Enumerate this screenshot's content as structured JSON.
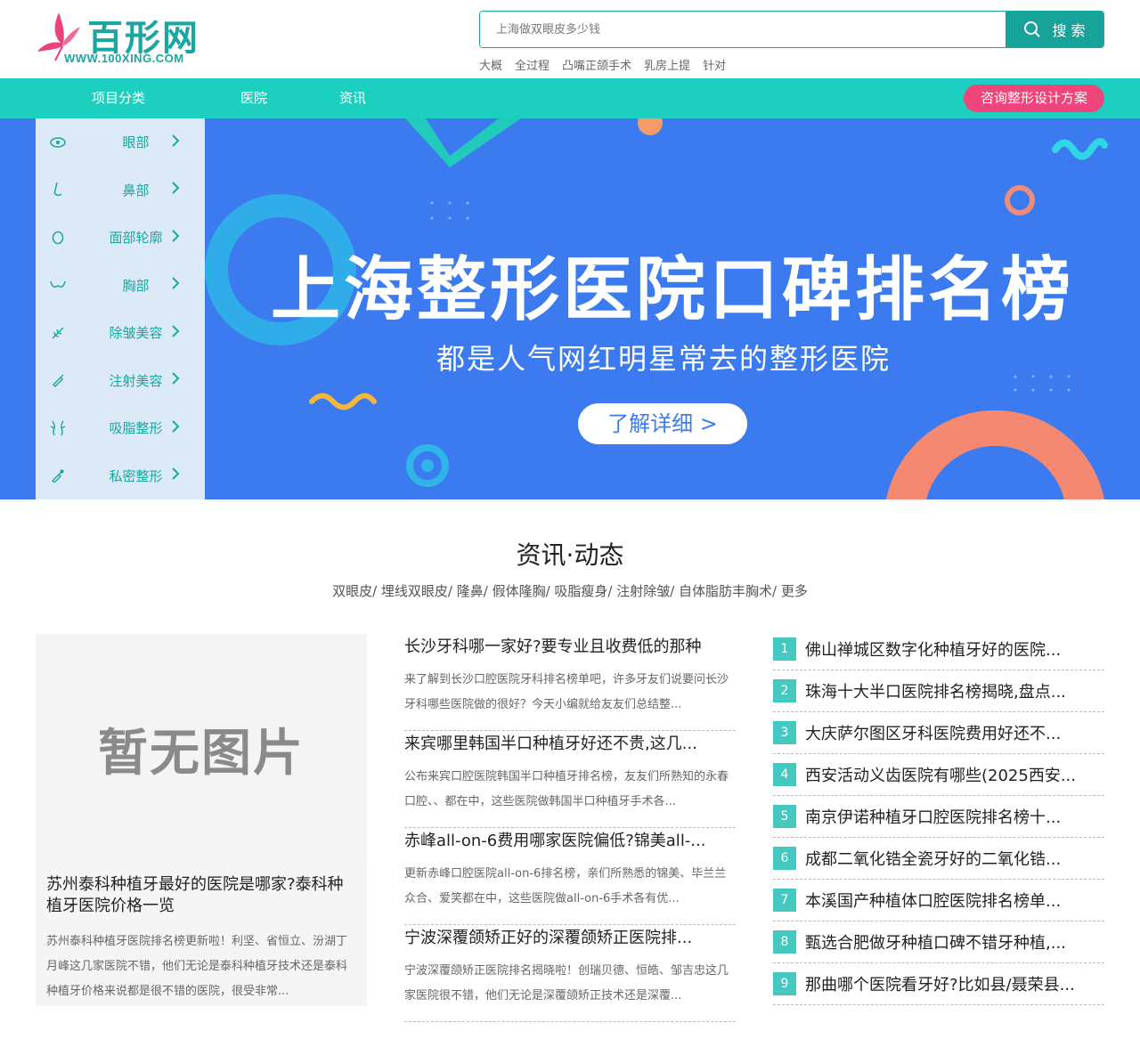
{
  "brand": {
    "name": "百形网",
    "url": "WWW.100XING.COM",
    "colors": {
      "teal": "#1ccfbe",
      "dark_teal": "#17a29a",
      "pink": "#f0457a",
      "banner_blue": "#3b7bef"
    }
  },
  "search": {
    "placeholder": "上海做双眼皮多少钱",
    "button": "搜 索",
    "hot_words": [
      "大概",
      "全过程",
      "凸嘴正颌手术",
      "乳房上提",
      "针对"
    ]
  },
  "nav": {
    "items": [
      "项目分类",
      "医院",
      "资讯"
    ],
    "consult": "咨询整形设计方案"
  },
  "sidebar": {
    "items": [
      {
        "label": "眼部",
        "icon": "eye-icon"
      },
      {
        "label": "鼻部",
        "icon": "nose-icon"
      },
      {
        "label": "面部轮廓",
        "icon": "face-icon"
      },
      {
        "label": "胸部",
        "icon": "chest-icon"
      },
      {
        "label": "除皱美容",
        "icon": "feather-icon"
      },
      {
        "label": "注射美容",
        "icon": "syringe-icon"
      },
      {
        "label": "吸脂整形",
        "icon": "body-icon"
      },
      {
        "label": "私密整形",
        "icon": "dropper-icon"
      }
    ]
  },
  "banner": {
    "title": "上海整形医院口碑排名榜",
    "subtitle": "都是人气网红明星常去的整形医院",
    "button": "了解详细 >"
  },
  "news": {
    "title": "资讯·动态",
    "tags": "双眼皮/ 埋线双眼皮/ 隆鼻/ 假体隆胸/ 吸脂瘦身/ 注射除皱/ 自体脂肪丰胸术/ 更多",
    "feature": {
      "image_text": "暂无图片",
      "title": "苏州泰科种植牙最好的医院是哪家?泰科种植牙医院价格一览",
      "desc": "苏州泰科种植牙医院排名榜更新啦！利坚、省恒立、汾湖丁月峰这几家医院不错，他们无论是泰科种植牙技术还是泰科种植牙价格来说都是很不错的医院，很受非常..."
    },
    "middle": [
      {
        "title": "长沙牙科哪一家好?要专业且收费低的那种",
        "desc": "来了解到长沙口腔医院牙科排名榜单吧，许多牙友们说要问长沙牙科哪些医院做的很好？今天小编就给友友们总结整..."
      },
      {
        "title": "来宾哪里韩国半口种植牙好还不贵,这几...",
        "desc": "公布来宾口腔医院韩国半口种植牙排名榜，友友们所熟知的永春口腔、、都在中，这些医院做韩国半口种植牙手术各..."
      },
      {
        "title": "赤峰all-on-6费用哪家医院偏低?锦美all-...",
        "desc": "更新赤峰口腔医院all-on-6排名榜，亲们所熟悉的锦美、毕兰兰众合、爱笑都在中，这些医院做all-on-6手术各有优..."
      },
      {
        "title": "宁波深覆颌矫正好的深覆颌矫正医院排...",
        "desc": "宁波深覆颌矫正医院排名揭晓啦！创瑞贝德、恒皓、邹吉忠这几家医院很不错，他们无论是深覆颌矫正技术还是深覆..."
      }
    ],
    "ranking": [
      {
        "num": "1",
        "title": "佛山禅城区数字化种植牙好的医院..."
      },
      {
        "num": "2",
        "title": "珠海十大半口医院排名榜揭晓,盘点..."
      },
      {
        "num": "3",
        "title": "大庆萨尔图区牙科医院费用好还不..."
      },
      {
        "num": "4",
        "title": "西安活动义齿医院有哪些(2025西安..."
      },
      {
        "num": "5",
        "title": "南京伊诺种植牙口腔医院排名榜十..."
      },
      {
        "num": "6",
        "title": "成都二氧化锆全瓷牙好的二氧化锆..."
      },
      {
        "num": "7",
        "title": "本溪国产种植体口腔医院排名榜单..."
      },
      {
        "num": "8",
        "title": "甄选合肥做牙种植口碑不错牙种植,..."
      },
      {
        "num": "9",
        "title": "那曲哪个医院看牙好?比如县/聂荣县..."
      }
    ]
  }
}
